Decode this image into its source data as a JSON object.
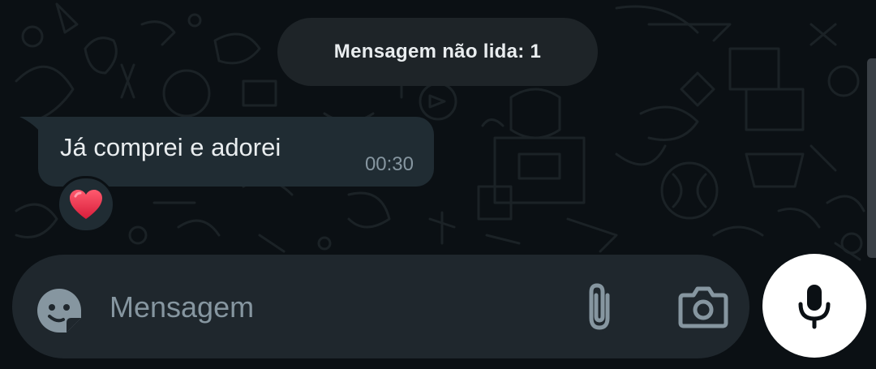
{
  "chat": {
    "unread_banner": "Mensagem não lida: 1",
    "message": {
      "text": "Já comprei e adorei",
      "time": "00:30",
      "reaction": "❤️"
    }
  },
  "composer": {
    "placeholder": "Mensagem",
    "value": "",
    "icons": {
      "sticker": "sticker-icon",
      "attach": "paperclip-icon",
      "camera": "camera-icon",
      "mic": "mic-icon"
    }
  },
  "colors": {
    "background": "#0b1014",
    "bubble": "#202c33",
    "input_bar": "#1f272d",
    "text_primary": "#e9edef",
    "text_secondary": "#8696a0",
    "heart": "#e8344f",
    "mic_button": "#ffffff"
  }
}
